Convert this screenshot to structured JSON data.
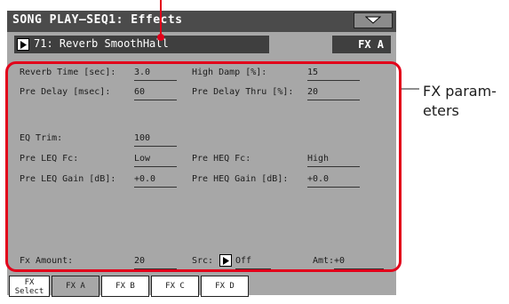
{
  "header": {
    "title": "SONG PLAY–SEQ1: Effects"
  },
  "fx_selector": {
    "name": "71: Reverb SmoothHall",
    "slot": "FX A"
  },
  "params": {
    "reverb_time_label": "Reverb Time [sec]:",
    "reverb_time_value": "3.0",
    "high_damp_label": "High Damp [%]:",
    "high_damp_value": "15",
    "pre_delay_label": "Pre Delay [msec]:",
    "pre_delay_value": "60",
    "pre_delay_thru_label": "Pre Delay Thru [%]:",
    "pre_delay_thru_value": "20",
    "eq_trim_label": "EQ Trim:",
    "eq_trim_value": "100",
    "pre_leq_fc_label": "Pre LEQ Fc:",
    "pre_leq_fc_value": "Low",
    "pre_heq_fc_label": "Pre HEQ Fc:",
    "pre_heq_fc_value": "High",
    "pre_leq_gain_label": "Pre LEQ Gain [dB]:",
    "pre_leq_gain_value": "+0.0",
    "pre_heq_gain_label": "Pre HEQ Gain [dB]:",
    "pre_heq_gain_value": "+0.0",
    "fx_amount_label": "Fx Amount:",
    "fx_amount_value": "20",
    "src_label": "Src:",
    "src_value": "Off",
    "amt_label": "Amt:",
    "amt_value": "+0"
  },
  "tabs": [
    {
      "line1": "FX",
      "line2": "Select"
    },
    {
      "line1": "FX A"
    },
    {
      "line1": "FX B"
    },
    {
      "line1": "FX C"
    },
    {
      "line1": "FX D"
    }
  ],
  "annotation": {
    "line1": "FX param-",
    "line2": "eters"
  },
  "colors": {
    "highlight": "#e2001a",
    "screen": "#a7a7a7",
    "dark": "#3f3f3f"
  }
}
